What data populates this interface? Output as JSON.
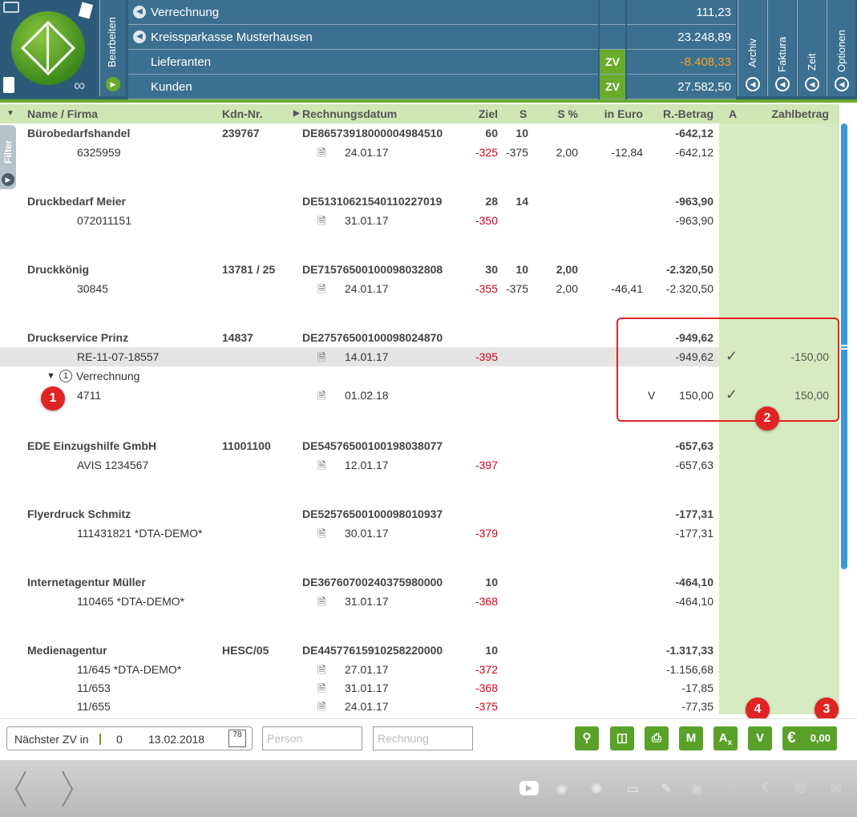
{
  "header": {
    "bearbeiten_label": "Bearbeiten",
    "rows": [
      {
        "label": "Verrechnung",
        "zv": "",
        "value": "111,23",
        "negative": false,
        "has_btn": true
      },
      {
        "label": "Kreissparkasse Musterhausen",
        "zv": "",
        "value": "23.248,89",
        "negative": false,
        "has_btn": true
      },
      {
        "label": "Lieferanten",
        "zv": "ZV",
        "value": "-8.408,33",
        "negative": true,
        "has_btn": false
      },
      {
        "label": "Kunden",
        "zv": "ZV",
        "value": "27.582,50",
        "negative": false,
        "has_btn": false
      }
    ],
    "tabs": [
      "Archiv",
      "Faktura",
      "Zeit",
      "Optionen"
    ]
  },
  "filter_label": "Filter",
  "columns": {
    "name": "Name / Firma",
    "kdn": "Kdn-Nr.",
    "datum": "Rechnungsdatum",
    "ziel": "Ziel",
    "s": "S",
    "sp": "S %",
    "euro": "in Euro",
    "betrag": "R.-Betrag",
    "a": "A",
    "zahl": "Zahlbetrag"
  },
  "groups": [
    {
      "name": "Bürobedarfshandel",
      "kdn": "239767",
      "iban": "DE86573918000004984510",
      "ziel": "60",
      "s": "10",
      "sp": "",
      "betrag": "-642,12",
      "items": [
        {
          "nr": "6325959",
          "date": "24.01.17",
          "days": "-325",
          "s": "-375",
          "sp": "2,00",
          "euro": "-12,84",
          "betrag": "-642,12",
          "a": "",
          "zahl": ""
        }
      ]
    },
    {
      "name": "Druckbedarf Meier",
      "kdn": "",
      "iban": "DE51310621540110227019",
      "ziel": "28",
      "s": "14",
      "sp": "",
      "betrag": "-963,90",
      "items": [
        {
          "nr": "072011151",
          "date": "31.01.17",
          "days": "-350",
          "s": "",
          "sp": "",
          "euro": "",
          "betrag": "-963,90",
          "a": "",
          "zahl": ""
        }
      ]
    },
    {
      "name": "Druckkönig",
      "kdn": "13781 / 25",
      "iban": "DE71576500100098032808",
      "ziel": "30",
      "s": "10",
      "sp": "2,00",
      "betrag": "-2.320,50",
      "items": [
        {
          "nr": "30845",
          "date": "24.01.17",
          "days": "-355",
          "s": "-375",
          "sp": "2,00",
          "euro": "-46,41",
          "betrag": "-2.320,50",
          "a": "",
          "zahl": ""
        }
      ]
    },
    {
      "name": "Druckservice Prinz",
      "kdn": "14837",
      "iban": "DE27576500100098024870",
      "ziel": "",
      "s": "",
      "sp": "",
      "betrag": "-949,62",
      "items": [
        {
          "nr": "RE-11-07-18557",
          "date": "14.01.17",
          "days": "-395",
          "s": "",
          "sp": "",
          "euro": "",
          "betrag": "-949,62",
          "a": "✓",
          "zahl": "-150,00"
        }
      ],
      "sub": {
        "count": "1",
        "label": "Verrechnung",
        "nr": "4711",
        "date": "01.02.18",
        "euro": "V",
        "betrag": "150,00",
        "a": "✓",
        "zahl": "150,00"
      }
    },
    {
      "name": "EDE Einzugshilfe GmbH",
      "kdn": "11001100",
      "iban": "DE54576500100198038077",
      "ziel": "",
      "s": "",
      "sp": "",
      "betrag": "-657,63",
      "items": [
        {
          "nr": "AVIS 1234567",
          "date": "12.01.17",
          "days": "-397",
          "s": "",
          "sp": "",
          "euro": "",
          "betrag": "-657,63",
          "a": "",
          "zahl": ""
        }
      ]
    },
    {
      "name": "Flyerdruck Schmitz",
      "kdn": "",
      "iban": "DE52576500100098010937",
      "ziel": "",
      "s": "",
      "sp": "",
      "betrag": "-177,31",
      "items": [
        {
          "nr": "111431821 *DTA-DEMO*",
          "date": "30.01.17",
          "days": "-379",
          "s": "",
          "sp": "",
          "euro": "",
          "betrag": "-177,31",
          "a": "",
          "zahl": ""
        }
      ]
    },
    {
      "name": "Internetagentur Müller",
      "kdn": "",
      "iban": "DE36760700240375980000",
      "ziel": "10",
      "s": "",
      "sp": "",
      "betrag": "-464,10",
      "items": [
        {
          "nr": "110465 *DTA-DEMO*",
          "date": "31.01.17",
          "days": "-368",
          "s": "",
          "sp": "",
          "euro": "",
          "betrag": "-464,10",
          "a": "",
          "zahl": ""
        }
      ]
    },
    {
      "name": "Medienagentur",
      "kdn": "HESC/05",
      "iban": "DE44577615910258220000",
      "ziel": "10",
      "s": "",
      "sp": "",
      "betrag": "-1.317,33",
      "items": [
        {
          "nr": "11/645 *DTA-DEMO*",
          "date": "27.01.17",
          "days": "-372",
          "s": "",
          "sp": "",
          "euro": "",
          "betrag": "-1.156,68",
          "a": "",
          "zahl": ""
        },
        {
          "nr": "11/653",
          "date": "31.01.17",
          "days": "-368",
          "s": "",
          "sp": "",
          "euro": "",
          "betrag": "-17,85",
          "a": "",
          "zahl": ""
        },
        {
          "nr": "11/655",
          "date": "24.01.17",
          "days": "-375",
          "s": "",
          "sp": "",
          "euro": "",
          "betrag": "-77,35",
          "a": "",
          "zahl": ""
        }
      ]
    }
  ],
  "badges": [
    "1",
    "2",
    "3",
    "4"
  ],
  "bottom": {
    "next_zv_label": "Nächster ZV in",
    "next_zv_days": "0",
    "next_zv_date": "13.02.2018",
    "calendar_label": "78",
    "person_placeholder": "Person",
    "rechnung_placeholder": "Rechnung",
    "btn_m": "M",
    "btn_ax": "A",
    "btn_ax_sub": "x",
    "btn_v": "V",
    "euro_symbol": "€",
    "euro_value": "0,00"
  },
  "colors": {
    "accent_green": "#5aa12a",
    "header_blue": "#3c7090",
    "negative_orange": "#f4a321",
    "negative_red": "#d0021b",
    "annotation_red": "#e02424"
  }
}
